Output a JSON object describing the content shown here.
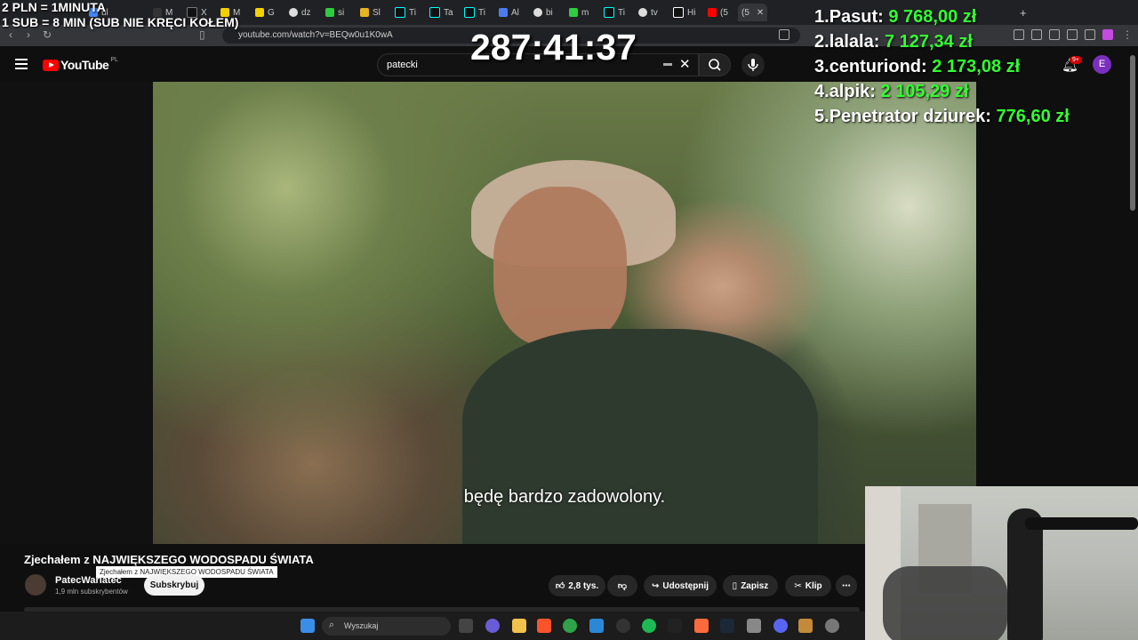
{
  "browser": {
    "tabs": [
      "ul",
      "M",
      "X",
      "M",
      "G",
      "dz",
      "si",
      "Sl",
      "Ti",
      "Ta",
      "Ti",
      "Al",
      "bi",
      "m",
      "Ti",
      "tv",
      "Hi",
      "(5"
    ],
    "active_tab_label": "(5",
    "url": "youtube.com/watch?v=BEQw0u1K0wA"
  },
  "youtube": {
    "logo_text": "YouTube",
    "region": "PL",
    "search_value": "patecki",
    "notification_count": "9+",
    "avatar_letter": "E"
  },
  "video": {
    "subtitle": "będę bardzo zadowolony.",
    "title": "Zjechałem z NAJWIĘKSZEGO WODOSPADU ŚWIATA",
    "tooltip": "Zjechałem z NAJWIĘKSZEGO WODOSPADU ŚWIATA",
    "channel_name": "PatecWariatec",
    "channel_subs": "1,9 mln subskrybentów",
    "subscribe_label": "Subskrybuj",
    "like_count": "2,8 tys.",
    "share_label": "Udostępnij",
    "save_label": "Zapisz",
    "clip_label": "Klip"
  },
  "taskbar": {
    "search_placeholder": "Wyszukaj"
  },
  "stream_overlay": {
    "rule_line_1": "2 PLN = 1MINUTA",
    "rule_line_2": "1 SUB = 8 MIN (SUB NIE KRĘCI KOŁEM)",
    "timer": "287:41:37",
    "leaderboard": [
      {
        "rank": "1.",
        "name": "Pasut:",
        "amount": "9 768,00 zł"
      },
      {
        "rank": "2.",
        "name": "lalala:",
        "amount": "7 127,34 zł"
      },
      {
        "rank": "3.",
        "name": "centuriond:",
        "amount": "2 173,08 zł"
      },
      {
        "rank": "4.",
        "name": "alpik:",
        "amount": "2 105,29 zł"
      },
      {
        "rank": "5.",
        "name": "Penetrator dziurek:",
        "amount": "776,60 zł"
      }
    ]
  },
  "colors": {
    "accent_red": "#ff0000",
    "amount_green": "#33ff33"
  }
}
